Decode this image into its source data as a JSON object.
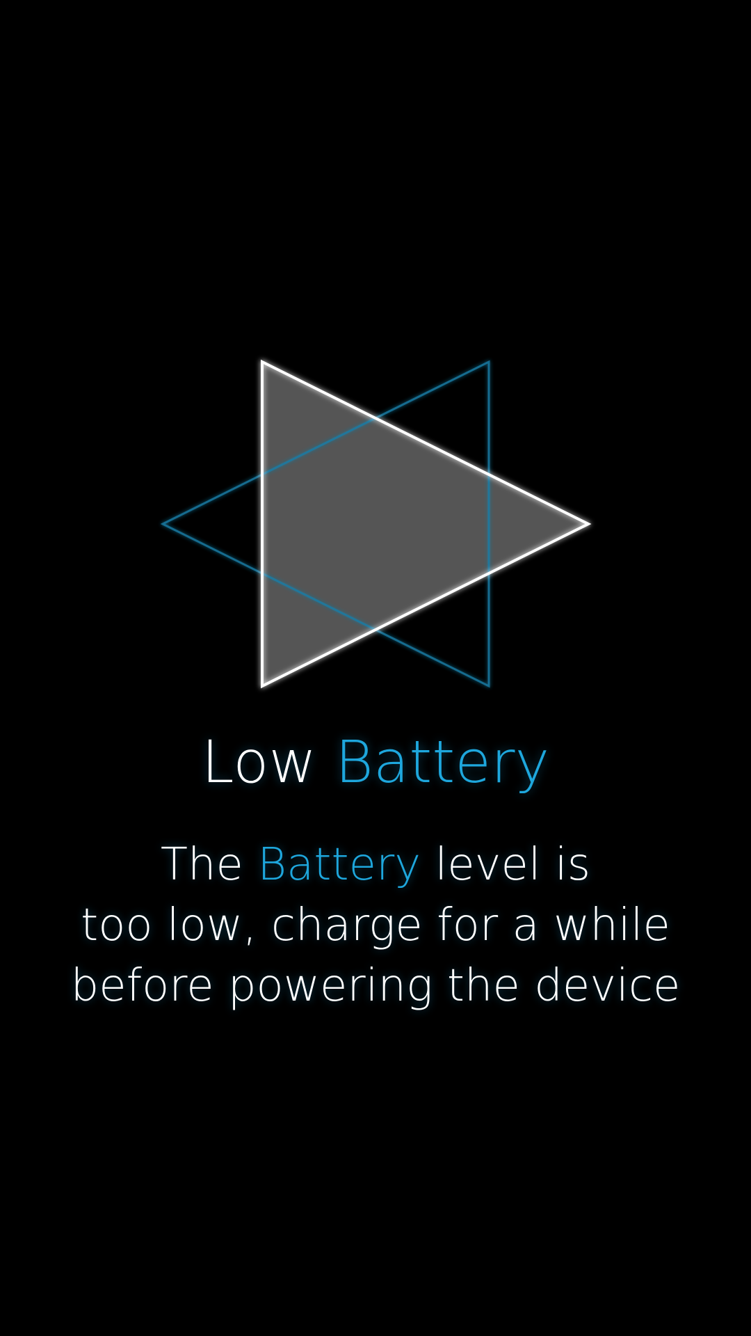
{
  "screen": {
    "background": "#000000",
    "accent_color": "#1ea7dd",
    "text_color": "#ffffff"
  },
  "logo": {
    "icon": "play-triangle-logo-icon",
    "fill_color": "#555555",
    "outline_color": "#ffffff",
    "secondary_outline_color": "#1a7da6"
  },
  "title": {
    "word_1": "Low",
    "word_2_accent": "Battery"
  },
  "message": {
    "line_1_prefix": "The",
    "line_1_accent": "Battery",
    "line_1_suffix": "level is",
    "line_2": "too low, charge for a while",
    "line_3": "before powering the device"
  }
}
